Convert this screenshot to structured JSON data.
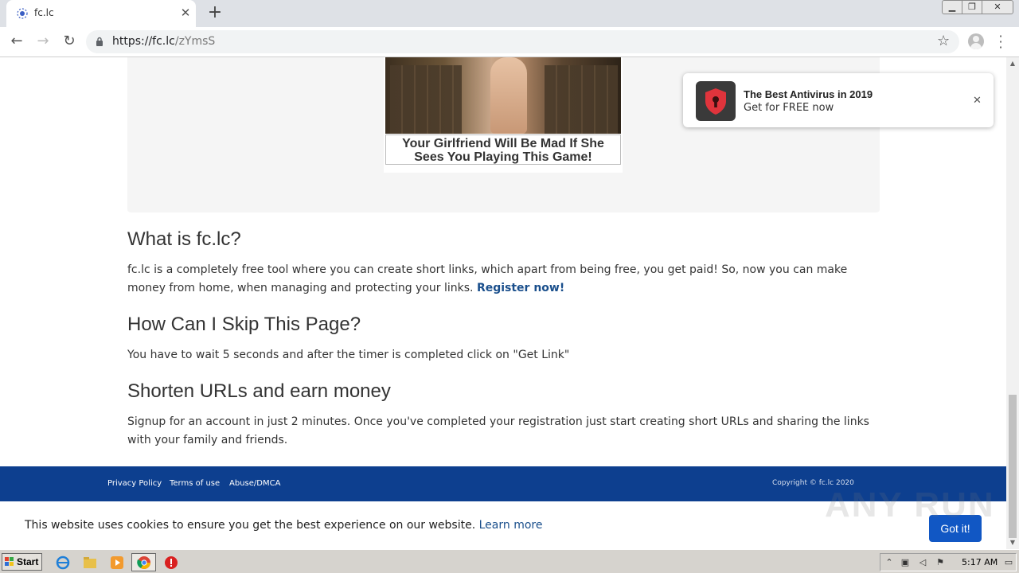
{
  "browser": {
    "tab_title": "fc.lc",
    "url_host": "https://fc.lc",
    "url_path": "/zYmsS",
    "new_tab_symbol": "+",
    "tab_close_symbol": "✕"
  },
  "ad": {
    "caption": "Your Girlfriend Will Be Mad If She Sees You Playing This Game!"
  },
  "content": {
    "what_title": "What is fc.lc?",
    "what_text": "fc.lc is a completely free tool where you can create short links, which apart from being free, you get paid! So, now you can make money from home, when managing and protecting your links.",
    "register_link": "Register now!",
    "skip_title": "How Can I Skip This Page?",
    "skip_text": "You have to wait 5 seconds and after the timer is completed click on \"Get Link\"",
    "shorten_title": "Shorten URLs and earn money",
    "shorten_text": "Signup for an account in just 2 minutes. Once you've completed your registration just start creating short URLs and sharing the links with your family and friends."
  },
  "footer": {
    "links": [
      "Privacy Policy",
      "Terms of use",
      "Abuse/DMCA"
    ],
    "copyright": "Copyright © fc.lc 2020"
  },
  "cookie": {
    "text": "This website uses cookies to ensure you get the best experience on our website.",
    "learn_more": "Learn more",
    "button": "Got it!"
  },
  "notification": {
    "title": "The Best Antivirus in 2019",
    "subtitle": "Get for FREE now",
    "close": "✕"
  },
  "watermark": "ANY RUN",
  "taskbar": {
    "start_label": "Start",
    "clock": "5:17 AM"
  },
  "colors": {
    "footer_bg": "#0d3f8f",
    "link": "#1a4f8c",
    "cookie_button": "#1157c4",
    "antivirus_red": "#e0343c"
  }
}
